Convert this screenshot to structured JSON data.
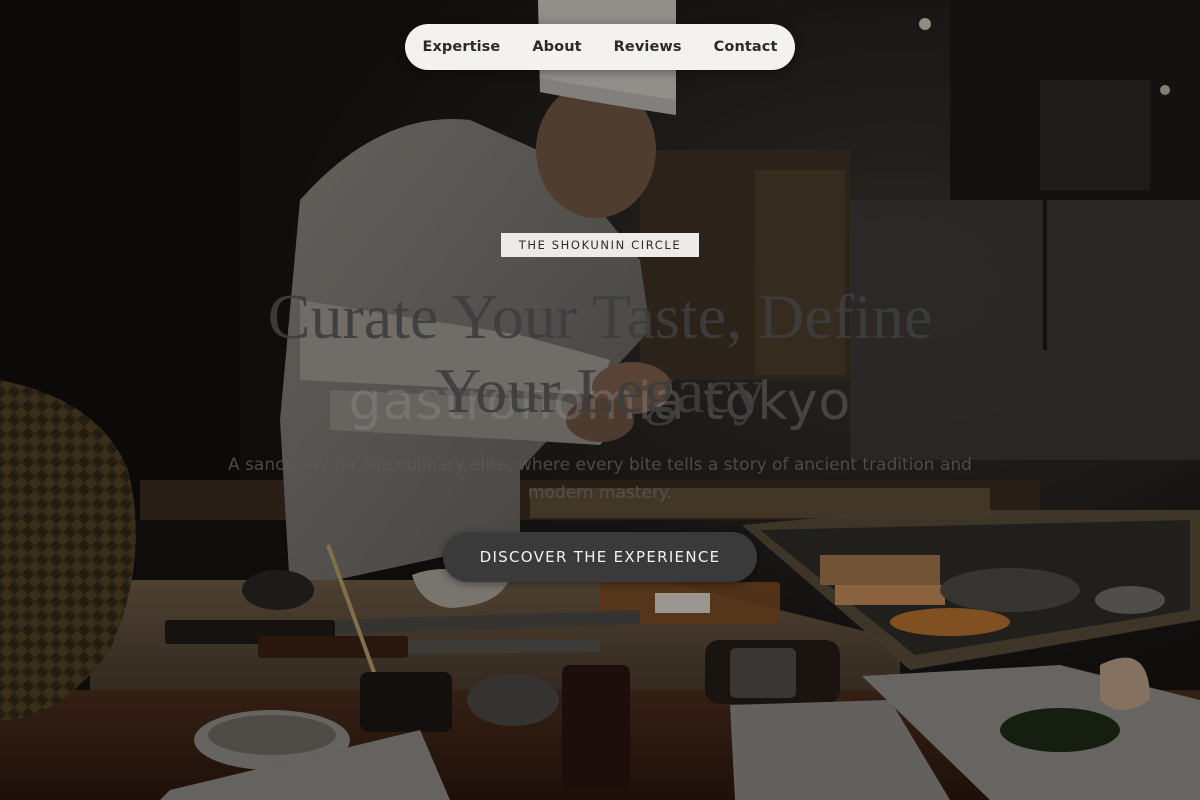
{
  "nav": {
    "items": [
      {
        "label": "Expertise"
      },
      {
        "label": "About"
      },
      {
        "label": "Reviews"
      },
      {
        "label": "Contact"
      }
    ]
  },
  "hero": {
    "eyebrow": "THE SHOKUNIN CIRCLE",
    "ghost_text": "gastronomia tokyo",
    "headline_line1": "Curate Your Taste, Define",
    "headline_line2": "Your Legacy",
    "subtitle_line1": "A sanctuary for the culinary elite, where every bite tells a story of ancient tradition and",
    "subtitle_line2": "modern mastery.",
    "cta_label": "DISCOVER THE EXPERIENCE"
  },
  "background": {
    "description_icon": "sushi-chef-photo"
  }
}
